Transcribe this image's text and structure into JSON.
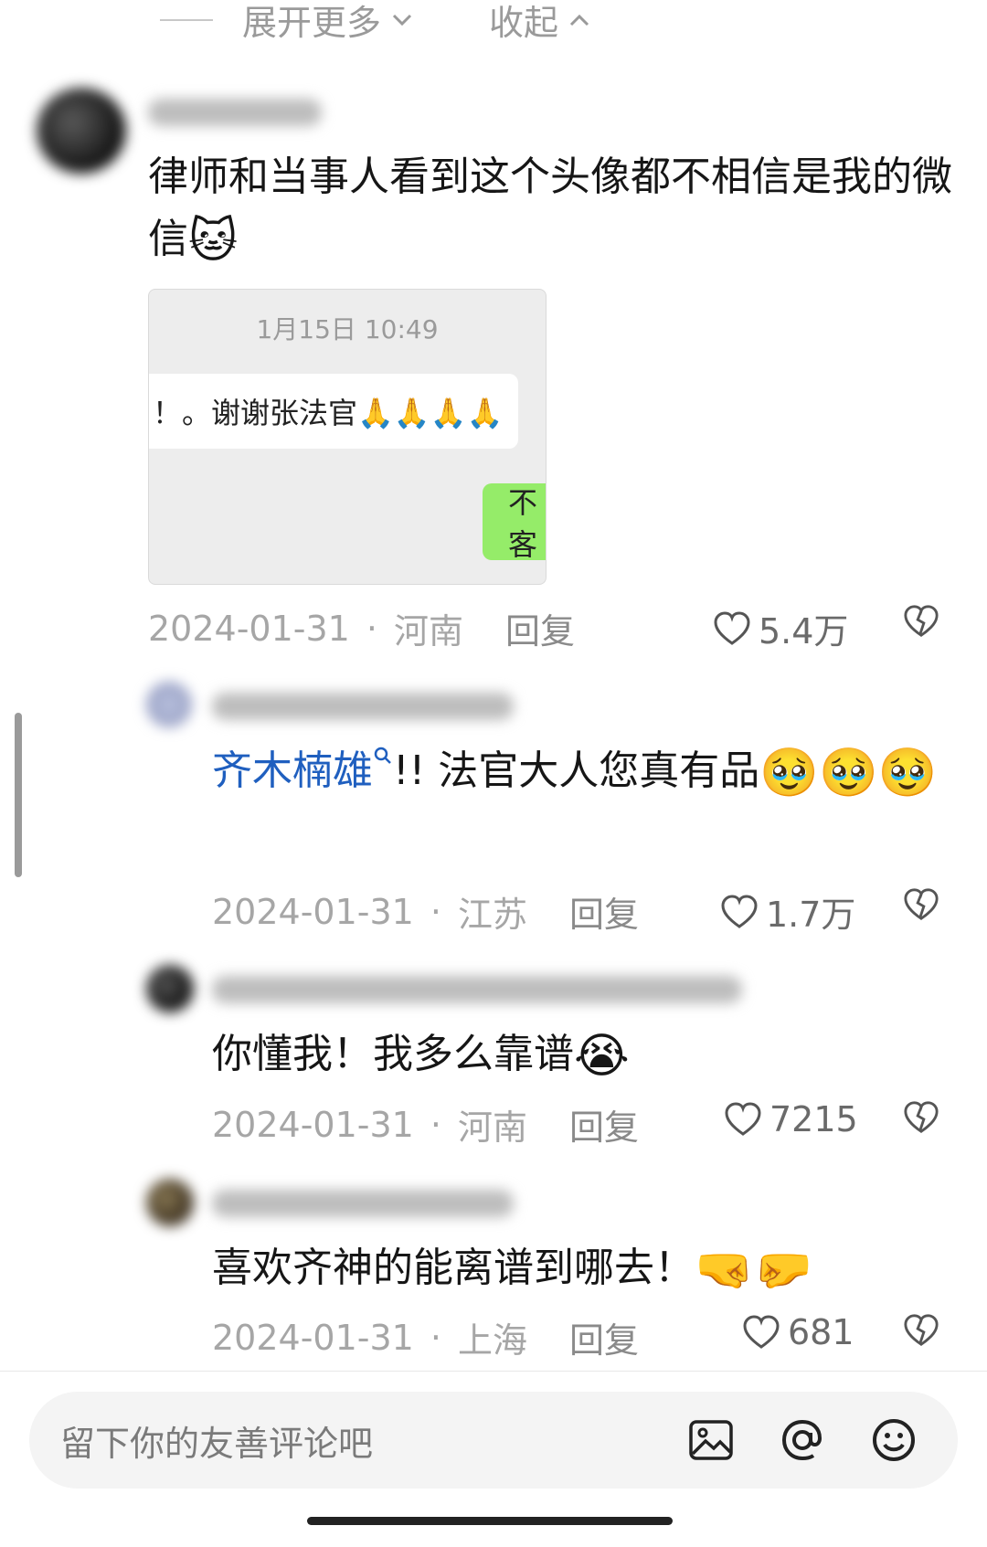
{
  "header": {
    "expand_more": "展开更多",
    "collapse": "收起"
  },
  "comments": [
    {
      "text": "律师和当事人看到这个头像都不相信是我的微信",
      "emoji": "🐱",
      "image": {
        "time": "1月15日 10:49",
        "left_msg": "！。谢谢张法官🙏🙏🙏🙏",
        "right_msg": "不客"
      },
      "date": "2024-01-31",
      "location": "河南",
      "reply_label": "回复",
      "likes": "5.4万"
    },
    {
      "mention": "齐木楠雄",
      "text": "!! 法官大人您真有品",
      "emoji": "🥹🥹🥹",
      "date": "2024-01-31",
      "location": "江苏",
      "reply_label": "回复",
      "likes": "1.7万"
    },
    {
      "text": "你懂我！我多么靠谱",
      "emoji": "😭",
      "date": "2024-01-31",
      "location": "河南",
      "reply_label": "回复",
      "likes": "7215"
    },
    {
      "text": "喜欢齐神的能离谱到哪去！",
      "emoji": "🤜🤛",
      "date": "2024-01-31",
      "location": "上海",
      "reply_label": "回复",
      "likes": "681"
    }
  ],
  "input": {
    "placeholder": "留下你的友善评论吧"
  },
  "colors": {
    "link": "#1f5fbf",
    "meta": "#a6a6a6",
    "bubble_green": "#95ec69"
  }
}
